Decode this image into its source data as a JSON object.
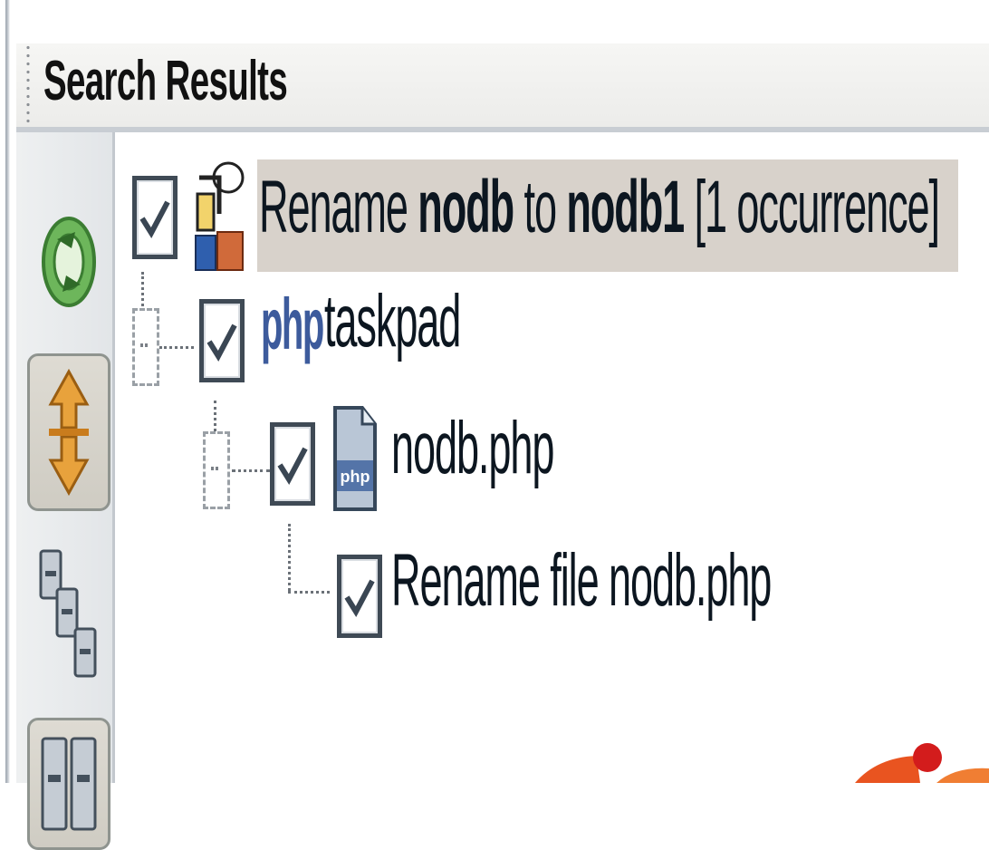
{
  "panel": {
    "title": "Search Results"
  },
  "toolbar": {
    "buttons": [
      {
        "name": "refresh",
        "icon": "refresh-icon",
        "pressed": false
      },
      {
        "name": "expand-collapse",
        "icon": "expand-collapse-icon",
        "pressed": true
      },
      {
        "name": "logical-view",
        "icon": "tree-view-icon",
        "pressed": false
      },
      {
        "name": "physical-view",
        "icon": "grid-view-icon",
        "pressed": false
      }
    ]
  },
  "tree": {
    "root": {
      "label_prefix": "Rename ",
      "label_old": "nodb",
      "label_mid": " to ",
      "label_new": "nodb1",
      "label_suffix": " [1 occurrence]",
      "checked": true,
      "icon": "refactor-icon"
    },
    "project": {
      "logo_text": "php",
      "label": "taskpad",
      "checked": true,
      "icon": "php-project-icon"
    },
    "file": {
      "label": "nodb.php",
      "checked": true,
      "icon": "php-file-icon"
    },
    "change": {
      "label": "Rename file nodb.php",
      "checked": true
    }
  },
  "colors": {
    "selection": "#d8d2cb",
    "php_blue": "#3d5b9c",
    "ubuntu_orange": "#e95420",
    "ubuntu_red": "#d31c1c"
  }
}
